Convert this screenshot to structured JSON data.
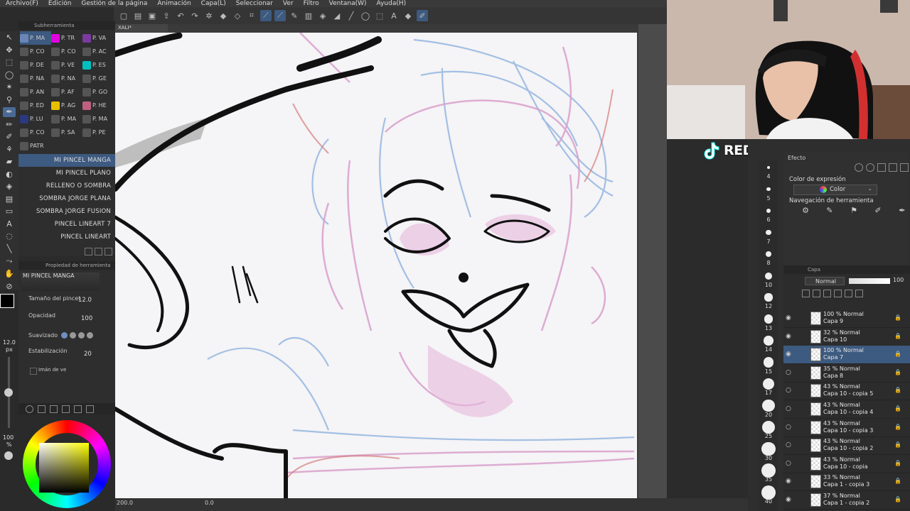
{
  "menu": [
    "Archivo(F)",
    "Edición",
    "Gestión de la página",
    "Animación",
    "Capa(L)",
    "Seleccionar",
    "Ver",
    "Filtro",
    "Ventana(W)",
    "Ayuda(H)"
  ],
  "canvas_tab": "XALI*",
  "subtool_panel": {
    "title": "Subherramienta",
    "grid": [
      {
        "label": "P. MA",
        "color": "#6a86b8",
        "selected": true
      },
      {
        "label": "P. TR",
        "color": "#e000e0",
        "selected": false
      },
      {
        "label": "P. VA",
        "color": "#7a3aa0",
        "selected": false
      },
      {
        "label": "P. CO",
        "color": "#555555",
        "selected": false
      },
      {
        "label": "P. CO",
        "color": "#555555",
        "selected": false
      },
      {
        "label": "P. AC",
        "color": "#555555",
        "selected": false
      },
      {
        "label": "P. DE",
        "color": "#555555",
        "selected": false
      },
      {
        "label": "P. VE",
        "color": "#555555",
        "selected": false
      },
      {
        "label": "P. ES",
        "color": "#00c0c0",
        "selected": false
      },
      {
        "label": "P. NA",
        "color": "#555555",
        "selected": false
      },
      {
        "label": "P. NA",
        "color": "#555555",
        "selected": false
      },
      {
        "label": "P. GE",
        "color": "#555555",
        "selected": false
      },
      {
        "label": "P. AN",
        "color": "#555555",
        "selected": false
      },
      {
        "label": "P. AF",
        "color": "#555555",
        "selected": false
      },
      {
        "label": "P. GO",
        "color": "#555555",
        "selected": false
      },
      {
        "label": "P. ED",
        "color": "#555555",
        "selected": false
      },
      {
        "label": "P. AG",
        "color": "#e8c000",
        "selected": false
      },
      {
        "label": "P. HE",
        "color": "#c06080",
        "selected": false
      },
      {
        "label": "P. LU",
        "color": "#2a3a80",
        "selected": false
      },
      {
        "label": "P. MA",
        "color": "#555555",
        "selected": false
      },
      {
        "label": "P. MA",
        "color": "#555555",
        "selected": false
      },
      {
        "label": "P. CO",
        "color": "#555555",
        "selected": false
      },
      {
        "label": "P. SA",
        "color": "#555555",
        "selected": false
      },
      {
        "label": "P. PE",
        "color": "#555555",
        "selected": false
      },
      {
        "label": "PATR",
        "color": "#555555",
        "selected": false
      }
    ],
    "brushes": [
      {
        "label": "MI PINCEL MANGA",
        "selected": true
      },
      {
        "label": "MI PINCEL PLANO",
        "selected": false
      },
      {
        "label": "RELLENO O SOMBRA",
        "selected": false
      },
      {
        "label": "SOMBRA JORGE PLANA",
        "selected": false
      },
      {
        "label": "SOMBRA JORGE FUSION",
        "selected": false
      },
      {
        "label": "PINCEL LINEART 7",
        "selected": false
      },
      {
        "label": "PINCEL LINEART",
        "selected": false
      }
    ]
  },
  "tool_property": {
    "title": "Propiedad de herramienta",
    "brush_name": "MI PINCEL MANGA",
    "size_label": "Tamaño del pincel",
    "size_value": "12.0",
    "opacity_label": "Opacidad",
    "opacity_value": "100",
    "smoothing_label": "Suavizado",
    "stabilization_label": "Estabilización",
    "stabilization_value": "20",
    "checkbox_label": "Imán de ve"
  },
  "left_indicator": {
    "size": "12.0",
    "unit": "px",
    "percent": "100",
    "percent_unit": "%"
  },
  "status": {
    "zoom": "200.0",
    "rotation": "0.0"
  },
  "stream": {
    "handle": "REDDEMON.OFICIAL"
  },
  "effect_panel": {
    "title": "Efecto",
    "expr_label": "Color de expresión",
    "expr_value": "Color",
    "nav_label": "Navegación de herramienta"
  },
  "layer_panel": {
    "title": "Capa",
    "blend_mode": "Normal",
    "opacity": "100",
    "layers": [
      {
        "blend": "100 % Normal",
        "name": "Capa 9",
        "visible": true,
        "selected": false
      },
      {
        "blend": "32 % Normal",
        "name": "Capa 10",
        "visible": true,
        "selected": false
      },
      {
        "blend": "100 % Normal",
        "name": "Capa 7",
        "visible": true,
        "selected": true
      },
      {
        "blend": "35 % Normal",
        "name": "Capa 8",
        "visible": false,
        "selected": false
      },
      {
        "blend": "43 % Normal",
        "name": "Capa 10 - copia 5",
        "visible": false,
        "selected": false
      },
      {
        "blend": "43 % Normal",
        "name": "Capa 10 - copia 4",
        "visible": false,
        "selected": false
      },
      {
        "blend": "43 % Normal",
        "name": "Capa 10 - copia 3",
        "visible": false,
        "selected": false
      },
      {
        "blend": "43 % Normal",
        "name": "Capa 10 - copia 2",
        "visible": false,
        "selected": false
      },
      {
        "blend": "43 % Normal",
        "name": "Capa 10 - copia",
        "visible": false,
        "selected": false
      },
      {
        "blend": "33 % Normal",
        "name": "Capa 1 - copia 3",
        "visible": true,
        "selected": false
      },
      {
        "blend": "37 % Normal",
        "name": "Capa 1 - copia 2",
        "visible": true,
        "selected": false
      }
    ]
  },
  "brush_size_list": [
    "4",
    "5",
    "6",
    "7",
    "8",
    "10",
    "12",
    "13",
    "14",
    "15",
    "17",
    "20",
    "25",
    "30",
    "35",
    "40"
  ]
}
